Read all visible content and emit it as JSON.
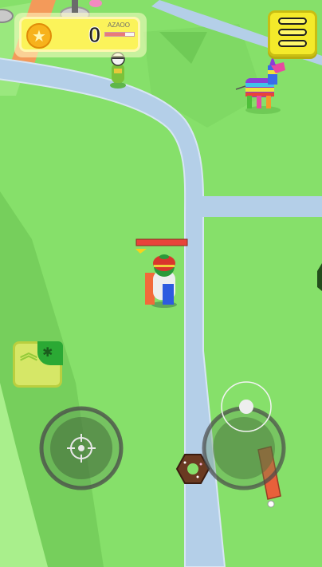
{
  "hud": {
    "score": "0",
    "player_name": "AZAOO",
    "star_icon": "★",
    "health_fraction": 0.7
  },
  "menu": {
    "icon": "hamburger-menu-icon"
  },
  "boost": {
    "chevrons": "︽",
    "badge_icon": "✱"
  },
  "colors": {
    "grass": "#86e06a",
    "road": "#b4cfe8",
    "hud_yellow": "#fbf35a",
    "player_hat": "#d9362c"
  }
}
